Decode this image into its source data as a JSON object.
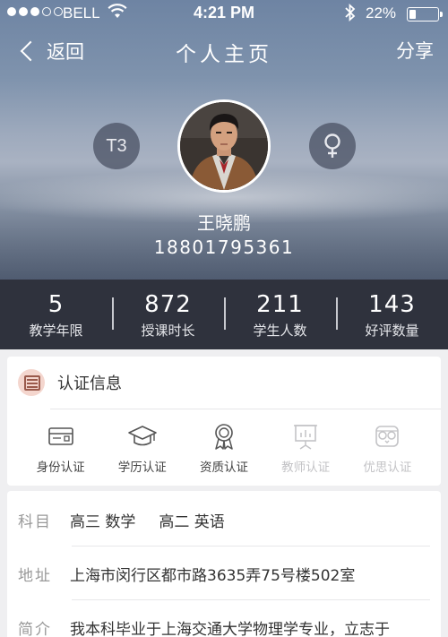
{
  "status_bar": {
    "carrier": "BELL",
    "time": "4:21 PM",
    "battery": "22%",
    "battery_level": 0.22,
    "signal_bars": 3
  },
  "nav": {
    "back_label": "返回",
    "title": "个人主页",
    "share_label": "分享"
  },
  "profile": {
    "level": "T3",
    "name": "王晓鹏",
    "phone": "18801795361",
    "gender_icon": "female-symbol-icon"
  },
  "stats": [
    {
      "value": "5",
      "label": "教学年限"
    },
    {
      "value": "872",
      "label": "授课时长"
    },
    {
      "value": "211",
      "label": "学生人数"
    },
    {
      "value": "143",
      "label": "好评数量"
    }
  ],
  "certification": {
    "title": "认证信息",
    "items": [
      {
        "label": "身份认证",
        "icon": "id-card-icon",
        "active": true
      },
      {
        "label": "学历认证",
        "icon": "graduation-cap-icon",
        "active": true
      },
      {
        "label": "资质认证",
        "icon": "award-ribbon-icon",
        "active": true
      },
      {
        "label": "教师认证",
        "icon": "teacher-board-icon",
        "active": false
      },
      {
        "label": "优思认证",
        "icon": "owl-icon",
        "active": false
      }
    ]
  },
  "info": {
    "subject_label": "科目",
    "subjects": [
      "高三 数学",
      "高二 英语"
    ],
    "address_label": "地址",
    "address": "上海市闵行区都市路3635弄75号楼502室",
    "intro_label": "简介",
    "intro": "我本科毕业于上海交通大学物理学专业，立志于"
  },
  "colors": {
    "stats_bar": "#2f323d",
    "page_bg": "#efeff1",
    "cert_icon_bg": "#f4d6ce"
  }
}
